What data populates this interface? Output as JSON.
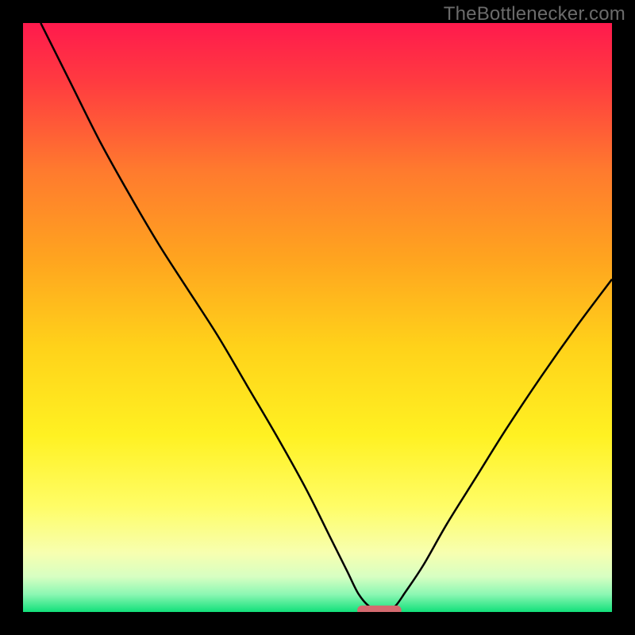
{
  "watermark": "TheBottlenecker.com",
  "chart_data": {
    "type": "line",
    "title": "",
    "xlabel": "",
    "ylabel": "",
    "xlim": [
      0,
      100
    ],
    "ylim": [
      0,
      100
    ],
    "background_gradient": {
      "stops": [
        {
          "offset": 0.0,
          "color": "#ff1a4d"
        },
        {
          "offset": 0.1,
          "color": "#ff3b40"
        },
        {
          "offset": 0.25,
          "color": "#ff7a2e"
        },
        {
          "offset": 0.4,
          "color": "#ffa41f"
        },
        {
          "offset": 0.55,
          "color": "#ffd21a"
        },
        {
          "offset": 0.7,
          "color": "#fff122"
        },
        {
          "offset": 0.82,
          "color": "#fffd66"
        },
        {
          "offset": 0.9,
          "color": "#f7ffb0"
        },
        {
          "offset": 0.94,
          "color": "#d7ffc2"
        },
        {
          "offset": 0.97,
          "color": "#8cf7b3"
        },
        {
          "offset": 1.0,
          "color": "#12e07a"
        }
      ]
    },
    "series": [
      {
        "name": "bottleneck-curve",
        "color": "#000000",
        "points": [
          {
            "x": 3.0,
            "y": 100.0
          },
          {
            "x": 8.0,
            "y": 90.0
          },
          {
            "x": 13.0,
            "y": 80.0
          },
          {
            "x": 18.0,
            "y": 71.0
          },
          {
            "x": 23.0,
            "y": 62.5
          },
          {
            "x": 27.5,
            "y": 55.5
          },
          {
            "x": 33.0,
            "y": 47.0
          },
          {
            "x": 38.0,
            "y": 38.5
          },
          {
            "x": 43.0,
            "y": 30.0
          },
          {
            "x": 48.0,
            "y": 21.0
          },
          {
            "x": 52.0,
            "y": 13.0
          },
          {
            "x": 55.0,
            "y": 7.0
          },
          {
            "x": 57.0,
            "y": 3.0
          },
          {
            "x": 59.0,
            "y": 0.8
          },
          {
            "x": 61.0,
            "y": 0.3
          },
          {
            "x": 63.0,
            "y": 0.8
          },
          {
            "x": 65.0,
            "y": 3.5
          },
          {
            "x": 68.0,
            "y": 8.0
          },
          {
            "x": 72.0,
            "y": 15.0
          },
          {
            "x": 77.0,
            "y": 23.0
          },
          {
            "x": 82.0,
            "y": 31.0
          },
          {
            "x": 88.0,
            "y": 40.0
          },
          {
            "x": 94.0,
            "y": 48.5
          },
          {
            "x": 100.0,
            "y": 56.5
          }
        ]
      }
    ],
    "marker": {
      "name": "optimal-zone",
      "shape": "pill",
      "color": "#d46a6f",
      "x_center": 60.5,
      "y": 0.3,
      "width": 7.5,
      "height": 1.6
    }
  }
}
